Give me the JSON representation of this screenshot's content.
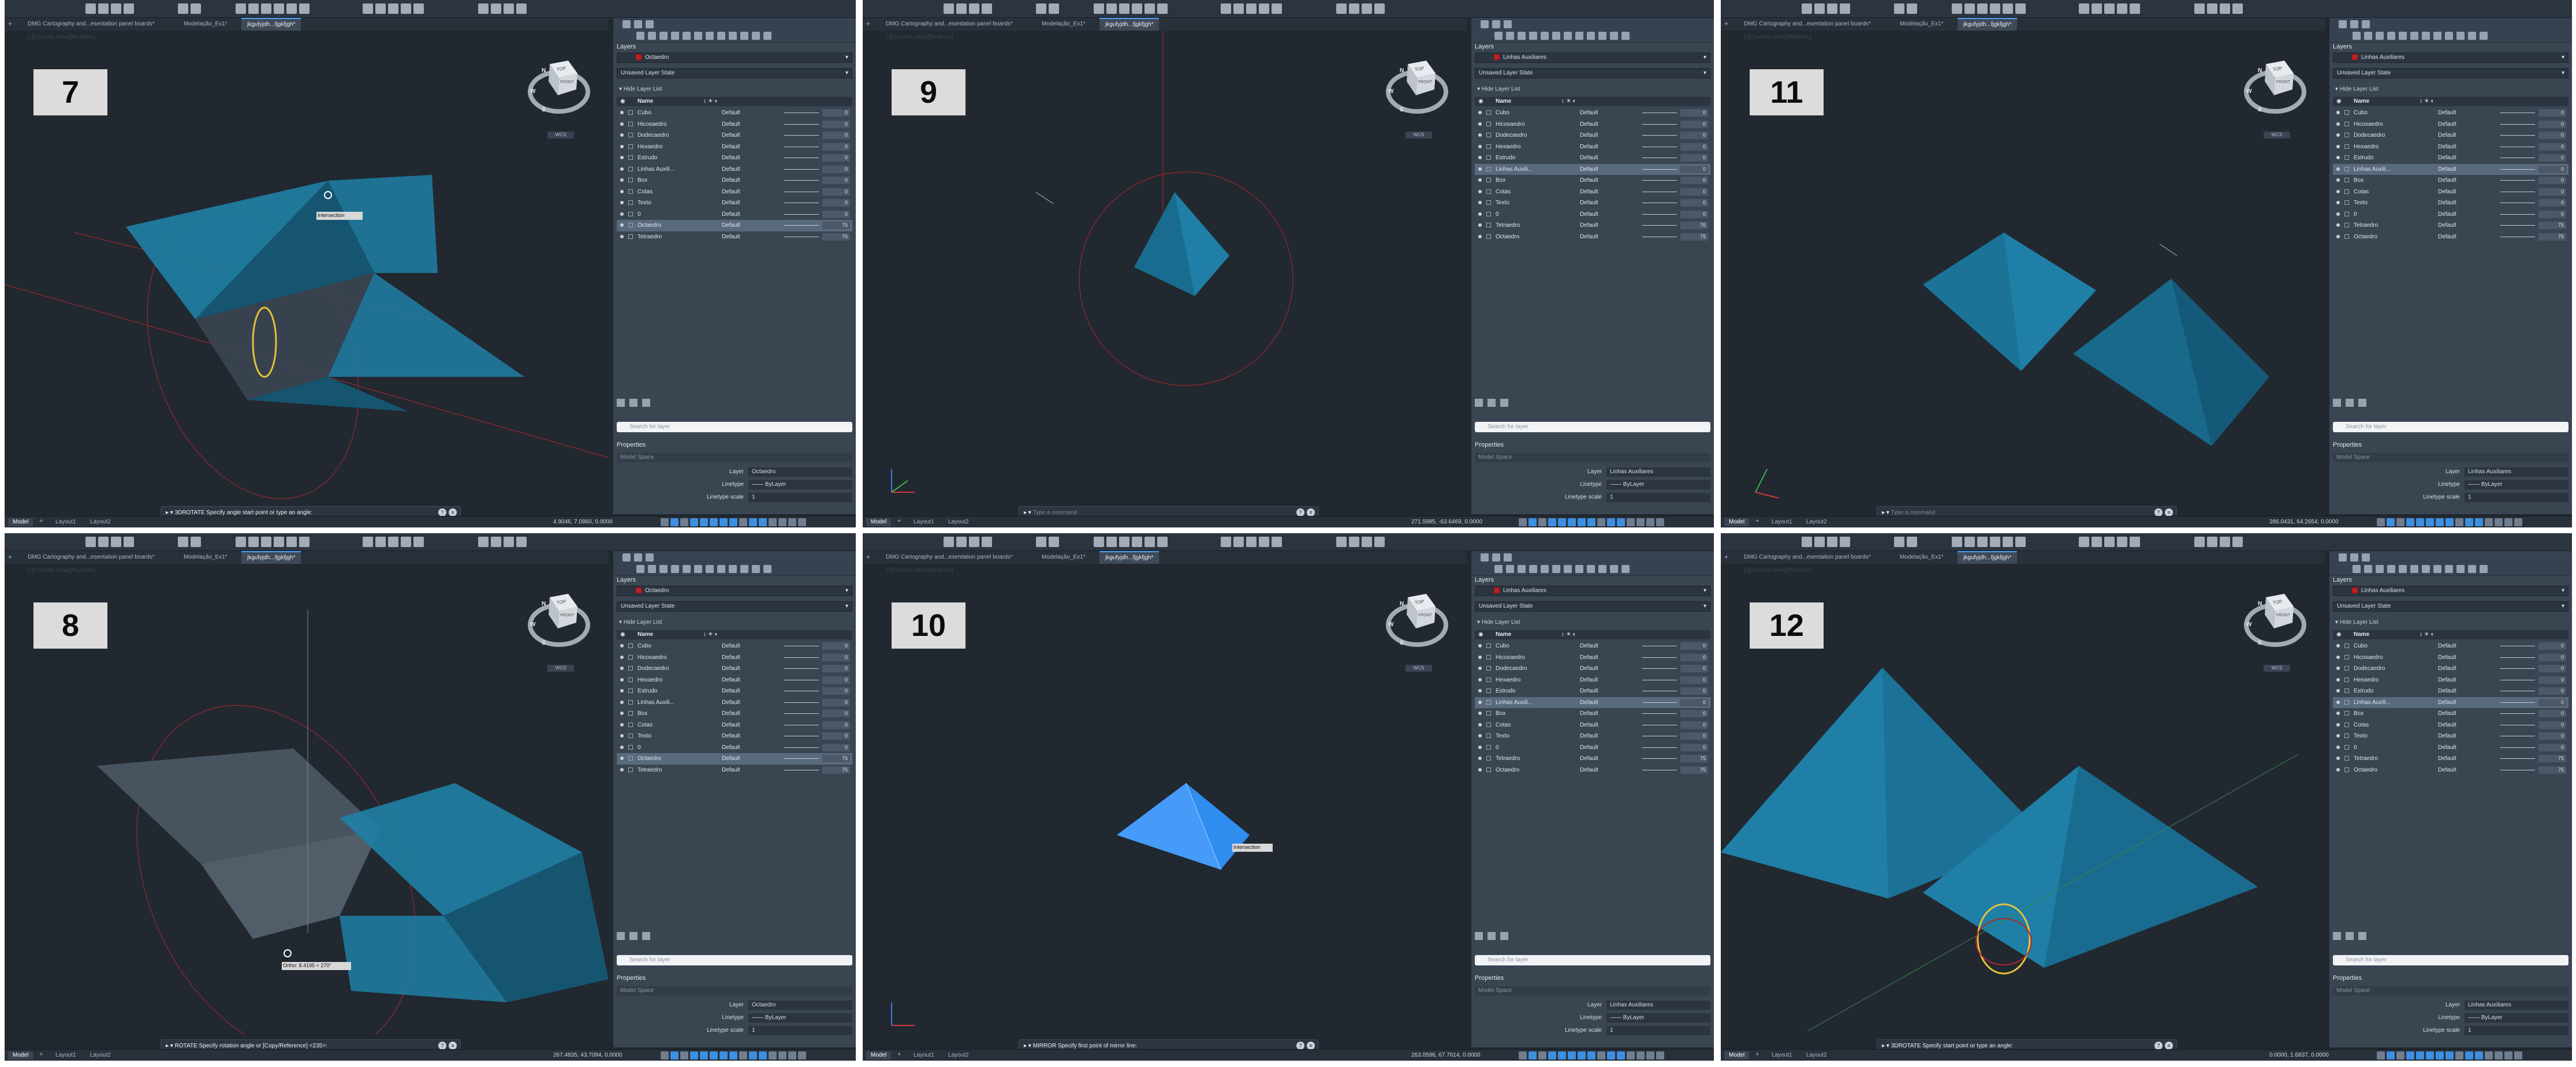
{
  "file_tabs": {
    "tab1": "DMG Cartography and...esentation panel boards*",
    "tab2": "Modelação_Ex1*",
    "tab3": "jkgufyjdh...fjgkfjgh*"
  },
  "status": {
    "model_tab": "Model",
    "layout1": "Layout1",
    "layout2": "Layout2"
  },
  "layers_panel": {
    "title": "Layers",
    "layer_state": "Unsaved Layer State",
    "hide_list": "Hide Layer List",
    "col_name": "Name",
    "search_placeholder": "Search for layer"
  },
  "properties_panel": {
    "title": "Properties",
    "model_space": "Model Space",
    "layer_key": "Layer",
    "linetype_key": "Linetype",
    "linetype_val": "ByLayer",
    "scale_key": "Linetype scale",
    "scale_val": "1"
  },
  "panels": [
    {
      "step": "7",
      "current_layer": "Octaedro",
      "command": "3DROTATE Specify angle start point or type an angle:",
      "tooltip": "Intersection",
      "coords": "4.9046, 7.0860, 0.0000",
      "layers": [
        {
          "name": "Cubo",
          "lt": "Default",
          "tr": "0"
        },
        {
          "name": "Hicosaedro",
          "lt": "Default",
          "tr": "0"
        },
        {
          "name": "Dodecaedro",
          "lt": "Default",
          "tr": "0"
        },
        {
          "name": "Hexaedro",
          "lt": "Default",
          "tr": "0"
        },
        {
          "name": "Estrudo",
          "lt": "Default",
          "tr": "0"
        },
        {
          "name": "Linhas Auxili...",
          "lt": "Default",
          "tr": "0"
        },
        {
          "name": "Box",
          "lt": "Default",
          "tr": "0"
        },
        {
          "name": "Cotas",
          "lt": "Default",
          "tr": "0"
        },
        {
          "name": "Texto",
          "lt": "Default",
          "tr": "0"
        },
        {
          "name": "0",
          "lt": "Default",
          "tr": "0"
        },
        {
          "name": "Octaedro",
          "lt": "Default",
          "tr": "75"
        },
        {
          "name": "Tetraedro",
          "lt": "Default",
          "tr": "75"
        }
      ],
      "selected_index": 10
    },
    {
      "step": "9",
      "current_layer": "Linhas Auxiliares",
      "command": "Type a command",
      "tooltip": "",
      "coords": "271.5985, -63.6469, 0.0000",
      "layers": [
        {
          "name": "Cubo",
          "lt": "Default",
          "tr": "0"
        },
        {
          "name": "Hicosaedro",
          "lt": "Default",
          "tr": "0"
        },
        {
          "name": "Dodecaedro",
          "lt": "Default",
          "tr": "0"
        },
        {
          "name": "Hexaedro",
          "lt": "Default",
          "tr": "0"
        },
        {
          "name": "Estrudo",
          "lt": "Default",
          "tr": "0"
        },
        {
          "name": "Linhas Auxili...",
          "lt": "Default",
          "tr": "0"
        },
        {
          "name": "Box",
          "lt": "Default",
          "tr": "0"
        },
        {
          "name": "Cotas",
          "lt": "Default",
          "tr": "0"
        },
        {
          "name": "Texto",
          "lt": "Default",
          "tr": "0"
        },
        {
          "name": "0",
          "lt": "Default",
          "tr": "0"
        },
        {
          "name": "Tetraedro",
          "lt": "Default",
          "tr": "75"
        },
        {
          "name": "Octaedro",
          "lt": "Default",
          "tr": "75"
        }
      ],
      "selected_index": 5
    },
    {
      "step": "11",
      "current_layer": "Linhas Auxiliares",
      "command": "Type a command",
      "tooltip": "",
      "coords": "286.0431, 64.2654, 0.0000",
      "layers": [
        {
          "name": "Cubo",
          "lt": "Default",
          "tr": "0"
        },
        {
          "name": "Hicosaedro",
          "lt": "Default",
          "tr": "0"
        },
        {
          "name": "Dodecaedro",
          "lt": "Default",
          "tr": "0"
        },
        {
          "name": "Hexaedro",
          "lt": "Default",
          "tr": "0"
        },
        {
          "name": "Estrudo",
          "lt": "Default",
          "tr": "0"
        },
        {
          "name": "Linhas Auxili...",
          "lt": "Default",
          "tr": "0"
        },
        {
          "name": "Box",
          "lt": "Default",
          "tr": "0"
        },
        {
          "name": "Cotas",
          "lt": "Default",
          "tr": "0"
        },
        {
          "name": "Texto",
          "lt": "Default",
          "tr": "0"
        },
        {
          "name": "0",
          "lt": "Default",
          "tr": "0"
        },
        {
          "name": "Tetraedro",
          "lt": "Default",
          "tr": "75"
        },
        {
          "name": "Octaedro",
          "lt": "Default",
          "tr": "75"
        }
      ],
      "selected_index": 5
    },
    {
      "step": "8",
      "current_layer": "Octaedro",
      "command": "ROTATE Specify rotation angle or [Copy/Reference] <235>:",
      "tooltip": "Ortho: 8.4195 < 270°",
      "coords": "267.4835, 43.7094, 0.0000",
      "layers": [
        {
          "name": "Cubo",
          "lt": "Default",
          "tr": "0"
        },
        {
          "name": "Hicosaedro",
          "lt": "Default",
          "tr": "0"
        },
        {
          "name": "Dodecaedro",
          "lt": "Default",
          "tr": "0"
        },
        {
          "name": "Hexaedro",
          "lt": "Default",
          "tr": "0"
        },
        {
          "name": "Estrudo",
          "lt": "Default",
          "tr": "0"
        },
        {
          "name": "Linhas Auxili...",
          "lt": "Default",
          "tr": "0"
        },
        {
          "name": "Box",
          "lt": "Default",
          "tr": "0"
        },
        {
          "name": "Cotas",
          "lt": "Default",
          "tr": "0"
        },
        {
          "name": "Texto",
          "lt": "Default",
          "tr": "0"
        },
        {
          "name": "0",
          "lt": "Default",
          "tr": "0"
        },
        {
          "name": "Octaedro",
          "lt": "Default",
          "tr": "75"
        },
        {
          "name": "Tetraedro",
          "lt": "Default",
          "tr": "75"
        }
      ],
      "selected_index": 10
    },
    {
      "step": "10",
      "current_layer": "Linhas Auxiliares",
      "command": "MIRROR Specify first point of mirror line:",
      "tooltip": "Intersection",
      "coords": "263.0596, 67.7614, 0.0000",
      "layers": [
        {
          "name": "Cubo",
          "lt": "Default",
          "tr": "0"
        },
        {
          "name": "Hicosaedro",
          "lt": "Default",
          "tr": "0"
        },
        {
          "name": "Dodecaedro",
          "lt": "Default",
          "tr": "0"
        },
        {
          "name": "Hexaedro",
          "lt": "Default",
          "tr": "0"
        },
        {
          "name": "Estrudo",
          "lt": "Default",
          "tr": "0"
        },
        {
          "name": "Linhas Auxili...",
          "lt": "Default",
          "tr": "0"
        },
        {
          "name": "Box",
          "lt": "Default",
          "tr": "0"
        },
        {
          "name": "Cotas",
          "lt": "Default",
          "tr": "0"
        },
        {
          "name": "Texto",
          "lt": "Default",
          "tr": "0"
        },
        {
          "name": "0",
          "lt": "Default",
          "tr": "0"
        },
        {
          "name": "Tetraedro",
          "lt": "Default",
          "tr": "75"
        },
        {
          "name": "Octaedro",
          "lt": "Default",
          "tr": "75"
        }
      ],
      "selected_index": 5
    },
    {
      "step": "12",
      "current_layer": "Linhas Auxiliares",
      "command": "3DROTATE Specify start point or type an angle:",
      "tooltip": "",
      "coords": "0.0000, 1.6837, 0.0000",
      "layers": [
        {
          "name": "Cubo",
          "lt": "Default",
          "tr": "0"
        },
        {
          "name": "Hicosaedro",
          "lt": "Default",
          "tr": "0"
        },
        {
          "name": "Dodecaedro",
          "lt": "Default",
          "tr": "0"
        },
        {
          "name": "Hexaedro",
          "lt": "Default",
          "tr": "0"
        },
        {
          "name": "Estrudo",
          "lt": "Default",
          "tr": "0"
        },
        {
          "name": "Linhas Auxili...",
          "lt": "Default",
          "tr": "0"
        },
        {
          "name": "Box",
          "lt": "Default",
          "tr": "0"
        },
        {
          "name": "Cotas",
          "lt": "Default",
          "tr": "0"
        },
        {
          "name": "Texto",
          "lt": "Default",
          "tr": "0"
        },
        {
          "name": "0",
          "lt": "Default",
          "tr": "0"
        },
        {
          "name": "Tetraedro",
          "lt": "Default",
          "tr": "75"
        },
        {
          "name": "Octaedro",
          "lt": "Default",
          "tr": "75"
        }
      ],
      "selected_index": 5
    }
  ],
  "viewcube": {
    "top": "TOP",
    "front": "FRONT",
    "n": "N",
    "w": "W",
    "s": "S",
    "e": "E",
    "wcs": "WCS"
  },
  "colors": {
    "solid": "#1f7fa6",
    "solid_dark": "#145a78",
    "highlight": "#2f8df0",
    "red_aux": "#b3262b",
    "bg": "#212830"
  }
}
